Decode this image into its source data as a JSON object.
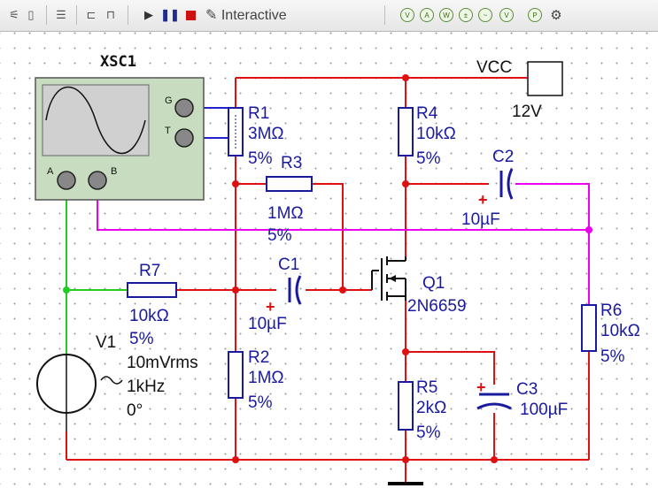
{
  "toolbar": {
    "interactive_label": "Interactive",
    "colors": {
      "run": "#333333",
      "pause": "#1f2d8c",
      "stop": "#d01010"
    }
  },
  "components": {
    "xsc1": {
      "ref": "XSC1",
      "pin_g": "G",
      "pin_t": "T",
      "pin_a": "A",
      "pin_b": "B"
    },
    "vcc": {
      "ref": "VCC",
      "value": "12V"
    },
    "r1": {
      "ref": "R1",
      "value": "3MΩ",
      "tol": "5%"
    },
    "r2": {
      "ref": "R2",
      "value": "1MΩ",
      "tol": "5%"
    },
    "r3": {
      "ref": "R3",
      "value": "1MΩ",
      "tol": "5%"
    },
    "r4": {
      "ref": "R4",
      "value": "10kΩ",
      "tol": "5%"
    },
    "r5": {
      "ref": "R5",
      "value": "2kΩ",
      "tol": "5%"
    },
    "r6": {
      "ref": "R6",
      "value": "10kΩ",
      "tol": "5%"
    },
    "r7": {
      "ref": "R7",
      "value": "10kΩ",
      "tol": "5%"
    },
    "c1": {
      "ref": "C1",
      "value": "10µF",
      "polarity": "+"
    },
    "c2": {
      "ref": "C2",
      "value": "10µF",
      "polarity": "+"
    },
    "c3": {
      "ref": "C3",
      "value": "100µF",
      "polarity": "+"
    },
    "q1": {
      "ref": "Q1",
      "part": "2N6659"
    },
    "v1": {
      "ref": "V1",
      "amplitude": "10mVrms",
      "frequency": "1kHz",
      "phase": "0°"
    }
  },
  "wire_colors": {
    "red": "#e01010",
    "magenta": "#ee00ee",
    "green": "#22cc22",
    "blue": "#2222cc",
    "black": "#000000"
  }
}
